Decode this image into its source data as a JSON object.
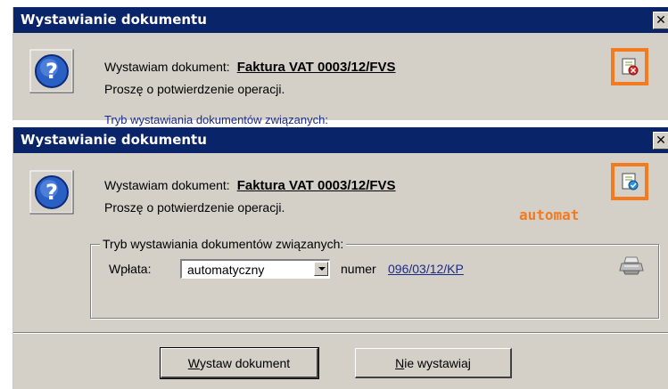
{
  "dialog1": {
    "title": "Wystawianie dokumentu",
    "close_glyph": "✕",
    "message_prefix": "Wystawiam dokument:",
    "document_name": "Faktura VAT 0003/12/FVS",
    "confirm_text": "Proszę o potwierdzenie operacji.",
    "cut_text": "Tryb wystawiania dokumentów związanych:",
    "corner_icon": "document-cancel-icon"
  },
  "dialog2": {
    "title": "Wystawianie dokumentu",
    "close_glyph": "✕",
    "message_prefix": "Wystawiam dokument:",
    "document_name": "Faktura VAT 0003/12/FVS",
    "confirm_text": "Proszę o potwierdzenie operacji.",
    "corner_icon": "document-auto-icon",
    "annotation": "automat",
    "group": {
      "legend": "Tryb wystawiania dokumentów związanych:",
      "wplata_label": "Wpłata:",
      "wplata_value": "automatyczny",
      "numer_label": "numer",
      "numer_value": "096/03/12/KP",
      "printer_icon": "printer-icon"
    },
    "buttons": {
      "wystaw_first": "W",
      "wystaw_rest": "ystaw dokument",
      "nie_first": "N",
      "nie_rest": "ie wystawiaj"
    }
  },
  "colors": {
    "titlebar": "#0a246a",
    "accent_orange": "#f47a20",
    "dialog_bg": "#d4d0c8",
    "link_blue": "#1a2a88"
  }
}
